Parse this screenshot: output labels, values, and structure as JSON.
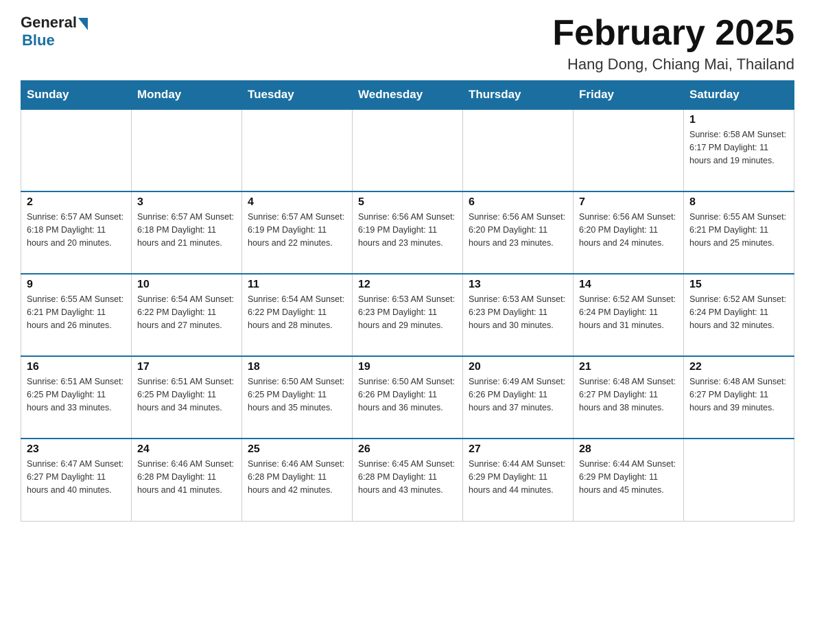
{
  "header": {
    "logo_general": "General",
    "logo_blue": "Blue",
    "title": "February 2025",
    "subtitle": "Hang Dong, Chiang Mai, Thailand"
  },
  "days_of_week": [
    "Sunday",
    "Monday",
    "Tuesday",
    "Wednesday",
    "Thursday",
    "Friday",
    "Saturday"
  ],
  "weeks": [
    [
      {
        "day": "",
        "info": ""
      },
      {
        "day": "",
        "info": ""
      },
      {
        "day": "",
        "info": ""
      },
      {
        "day": "",
        "info": ""
      },
      {
        "day": "",
        "info": ""
      },
      {
        "day": "",
        "info": ""
      },
      {
        "day": "1",
        "info": "Sunrise: 6:58 AM\nSunset: 6:17 PM\nDaylight: 11 hours and 19 minutes."
      }
    ],
    [
      {
        "day": "2",
        "info": "Sunrise: 6:57 AM\nSunset: 6:18 PM\nDaylight: 11 hours and 20 minutes."
      },
      {
        "day": "3",
        "info": "Sunrise: 6:57 AM\nSunset: 6:18 PM\nDaylight: 11 hours and 21 minutes."
      },
      {
        "day": "4",
        "info": "Sunrise: 6:57 AM\nSunset: 6:19 PM\nDaylight: 11 hours and 22 minutes."
      },
      {
        "day": "5",
        "info": "Sunrise: 6:56 AM\nSunset: 6:19 PM\nDaylight: 11 hours and 23 minutes."
      },
      {
        "day": "6",
        "info": "Sunrise: 6:56 AM\nSunset: 6:20 PM\nDaylight: 11 hours and 23 minutes."
      },
      {
        "day": "7",
        "info": "Sunrise: 6:56 AM\nSunset: 6:20 PM\nDaylight: 11 hours and 24 minutes."
      },
      {
        "day": "8",
        "info": "Sunrise: 6:55 AM\nSunset: 6:21 PM\nDaylight: 11 hours and 25 minutes."
      }
    ],
    [
      {
        "day": "9",
        "info": "Sunrise: 6:55 AM\nSunset: 6:21 PM\nDaylight: 11 hours and 26 minutes."
      },
      {
        "day": "10",
        "info": "Sunrise: 6:54 AM\nSunset: 6:22 PM\nDaylight: 11 hours and 27 minutes."
      },
      {
        "day": "11",
        "info": "Sunrise: 6:54 AM\nSunset: 6:22 PM\nDaylight: 11 hours and 28 minutes."
      },
      {
        "day": "12",
        "info": "Sunrise: 6:53 AM\nSunset: 6:23 PM\nDaylight: 11 hours and 29 minutes."
      },
      {
        "day": "13",
        "info": "Sunrise: 6:53 AM\nSunset: 6:23 PM\nDaylight: 11 hours and 30 minutes."
      },
      {
        "day": "14",
        "info": "Sunrise: 6:52 AM\nSunset: 6:24 PM\nDaylight: 11 hours and 31 minutes."
      },
      {
        "day": "15",
        "info": "Sunrise: 6:52 AM\nSunset: 6:24 PM\nDaylight: 11 hours and 32 minutes."
      }
    ],
    [
      {
        "day": "16",
        "info": "Sunrise: 6:51 AM\nSunset: 6:25 PM\nDaylight: 11 hours and 33 minutes."
      },
      {
        "day": "17",
        "info": "Sunrise: 6:51 AM\nSunset: 6:25 PM\nDaylight: 11 hours and 34 minutes."
      },
      {
        "day": "18",
        "info": "Sunrise: 6:50 AM\nSunset: 6:25 PM\nDaylight: 11 hours and 35 minutes."
      },
      {
        "day": "19",
        "info": "Sunrise: 6:50 AM\nSunset: 6:26 PM\nDaylight: 11 hours and 36 minutes."
      },
      {
        "day": "20",
        "info": "Sunrise: 6:49 AM\nSunset: 6:26 PM\nDaylight: 11 hours and 37 minutes."
      },
      {
        "day": "21",
        "info": "Sunrise: 6:48 AM\nSunset: 6:27 PM\nDaylight: 11 hours and 38 minutes."
      },
      {
        "day": "22",
        "info": "Sunrise: 6:48 AM\nSunset: 6:27 PM\nDaylight: 11 hours and 39 minutes."
      }
    ],
    [
      {
        "day": "23",
        "info": "Sunrise: 6:47 AM\nSunset: 6:27 PM\nDaylight: 11 hours and 40 minutes."
      },
      {
        "day": "24",
        "info": "Sunrise: 6:46 AM\nSunset: 6:28 PM\nDaylight: 11 hours and 41 minutes."
      },
      {
        "day": "25",
        "info": "Sunrise: 6:46 AM\nSunset: 6:28 PM\nDaylight: 11 hours and 42 minutes."
      },
      {
        "day": "26",
        "info": "Sunrise: 6:45 AM\nSunset: 6:28 PM\nDaylight: 11 hours and 43 minutes."
      },
      {
        "day": "27",
        "info": "Sunrise: 6:44 AM\nSunset: 6:29 PM\nDaylight: 11 hours and 44 minutes."
      },
      {
        "day": "28",
        "info": "Sunrise: 6:44 AM\nSunset: 6:29 PM\nDaylight: 11 hours and 45 minutes."
      },
      {
        "day": "",
        "info": ""
      }
    ]
  ]
}
